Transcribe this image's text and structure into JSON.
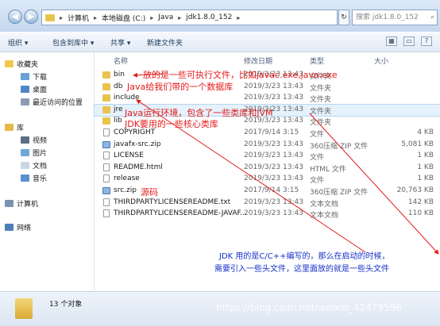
{
  "address": {
    "crumbs": [
      "计算机",
      "本地磁盘 (C:)",
      "Java",
      "jdk1.8.0_152"
    ],
    "search_placeholder": "搜索 jdk1.8.0_152"
  },
  "toolbar": {
    "organize": "组织 ▾",
    "include_library": "包含到库中 ▾",
    "share": "共享 ▾",
    "new_folder": "新建文件夹"
  },
  "sidebar": {
    "favorites": "收藏夹",
    "downloads": "下载",
    "desktop": "桌面",
    "recent": "最近访问的位置",
    "libraries": "库",
    "videos": "视频",
    "pictures": "图片",
    "documents": "文档",
    "music": "音乐",
    "computer": "计算机",
    "network": "网络"
  },
  "columns": {
    "name": "名称",
    "date": "修改日期",
    "type": "类型",
    "size": "大小"
  },
  "files": [
    {
      "name": "bin",
      "date": "2019/3/23 13:43",
      "type": "文件夹",
      "size": "",
      "icon": "folder"
    },
    {
      "name": "db",
      "date": "2019/3/23 13:43",
      "type": "文件夹",
      "size": "",
      "icon": "folder"
    },
    {
      "name": "include",
      "date": "2019/3/23 13:43",
      "type": "文件夹",
      "size": "",
      "icon": "folder"
    },
    {
      "name": "jre",
      "date": "2019/3/23 13:43",
      "type": "文件夹",
      "size": "",
      "icon": "folder"
    },
    {
      "name": "lib",
      "date": "2019/3/23 13:43",
      "type": "文件夹",
      "size": "",
      "icon": "folder"
    },
    {
      "name": "COPYRIGHT",
      "date": "2017/9/14 3:15",
      "type": "文件",
      "size": "4 KB",
      "icon": "file"
    },
    {
      "name": "javafx-src.zip",
      "date": "2019/3/23 13:43",
      "type": "360压缩 ZIP 文件",
      "size": "5,081 KB",
      "icon": "zip"
    },
    {
      "name": "LICENSE",
      "date": "2019/3/23 13:43",
      "type": "文件",
      "size": "1 KB",
      "icon": "file"
    },
    {
      "name": "README.html",
      "date": "2019/3/23 13:43",
      "type": "HTML 文件",
      "size": "1 KB",
      "icon": "file"
    },
    {
      "name": "release",
      "date": "2019/3/23 13:43",
      "type": "文件",
      "size": "1 KB",
      "icon": "file"
    },
    {
      "name": "src.zip",
      "date": "2017/9/14 3:15",
      "type": "360压缩 ZIP 文件",
      "size": "20,763 KB",
      "icon": "zip"
    },
    {
      "name": "THIRDPARTYLICENSEREADME.txt",
      "date": "2019/3/23 13:43",
      "type": "文本文档",
      "size": "142 KB",
      "icon": "file"
    },
    {
      "name": "THIRDPARTYLICENSEREADME-JAVAF...",
      "date": "2019/3/23 13:43",
      "type": "文本文档",
      "size": "110 KB",
      "icon": "file"
    }
  ],
  "status": {
    "count": "13 个对象"
  },
  "annotations": {
    "bin": "放的是一些可执行文件，比如javac.exe,java.exe",
    "db": "Java给我们带的一个数据库",
    "jre": "Java运行环境，包含了一些类库和JVM",
    "lib": "JDK要用的一些核心类库",
    "src": "源码",
    "include_line1": "JDK 用的是C/C++编写的，那么在启动的时候，",
    "include_line2": "需要引入一些头文件，这里面放的就是一些头文件"
  },
  "watermark": "https://blog.csdn.net/weixin_42479596"
}
